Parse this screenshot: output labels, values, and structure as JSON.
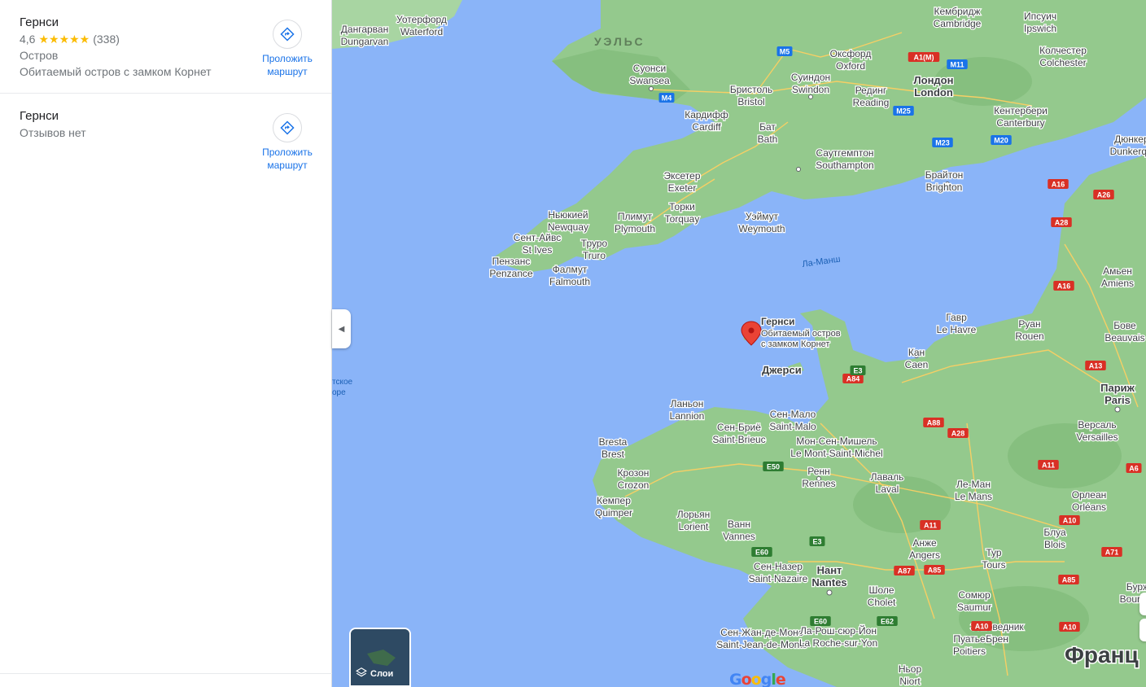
{
  "results": [
    {
      "title": "Гернси",
      "rating_value": "4,6",
      "stars": "★★★★★",
      "rating_stars": 4.6,
      "review_count": "(338)",
      "category": "Остров",
      "description": "Обитаемый остров с замком Корнет",
      "route_label_1": "Проложить",
      "route_label_2": "маршрут"
    },
    {
      "title": "Гернси",
      "reviews_text": "Отзывов нет",
      "route_label_1": "Проложить",
      "route_label_2": "маршрут"
    }
  ],
  "map": {
    "layers_label": "Слои",
    "google_logo": {
      "G": "G",
      "o1": "o",
      "o2": "o",
      "g": "g",
      "l": "l",
      "e": "e"
    },
    "pin": {
      "title": "Гернси",
      "desc_1": "Обитаемый остров",
      "desc_2": "с замком Корнет"
    },
    "region_labels": {
      "wales": "УЭЛЬС",
      "channel": "Ла-Манш",
      "sea_1": "тское",
      "sea_2": "оре",
      "france": "Франц"
    },
    "places": [
      {
        "ru": "Уотерфорд",
        "en": "Waterford"
      },
      {
        "ru": "Дангарван",
        "en": "Dungarvan"
      },
      {
        "ru": "Суонси",
        "en": "Swansea"
      },
      {
        "ru": "Бристоль",
        "en": "Bristol"
      },
      {
        "ru": "Кардифф",
        "en": "Cardiff"
      },
      {
        "ru": "Бат",
        "en": "Bath"
      },
      {
        "ru": "Оксфорд",
        "en": "Oxford"
      },
      {
        "ru": "Суиндон",
        "en": "Swindon"
      },
      {
        "ru": "Рединг",
        "en": "Reading"
      },
      {
        "ru": "Лондон",
        "en": "London"
      },
      {
        "ru": "Кембридж",
        "en": "Cambridge"
      },
      {
        "ru": "Ипсуич",
        "en": "Ipswich"
      },
      {
        "ru": "Колчестер",
        "en": "Colchester"
      },
      {
        "ru": "Кентербери",
        "en": "Canterbury"
      },
      {
        "ru": "Дюнкерк",
        "en": "Dunkerque"
      },
      {
        "ru": "Саутгемптон",
        "en": "Southampton"
      },
      {
        "ru": "Брайтон",
        "en": "Brighton"
      },
      {
        "ru": "Эксетер",
        "en": "Exeter"
      },
      {
        "ru": "Торки",
        "en": "Torquay"
      },
      {
        "ru": "Уэймут",
        "en": "Weymouth"
      },
      {
        "ru": "Плимут",
        "en": "Plymouth"
      },
      {
        "ru": "Ньюкией",
        "en": "Newquay"
      },
      {
        "ru": "Сент-Айвс",
        "en": "St Ives"
      },
      {
        "ru": "Труро",
        "en": "Truro"
      },
      {
        "ru": "Пензанс",
        "en": "Penzance"
      },
      {
        "ru": "Фалмут",
        "en": "Falmouth"
      },
      {
        "ru": "Гавр",
        "en": "Le Havre"
      },
      {
        "ru": "Руан",
        "en": "Rouen"
      },
      {
        "ru": "Бове",
        "en": "Beauvais"
      },
      {
        "ru": "Амьен",
        "en": "Amiens"
      },
      {
        "ru": "Кан",
        "en": "Caen"
      },
      {
        "ru": "Париж",
        "en": "Paris"
      },
      {
        "ru": "Версаль",
        "en": "Versailles"
      },
      {
        "ru": "Ланьон",
        "en": "Lannion"
      },
      {
        "ru": "Сен-Бриё",
        "en": "Saint-Brieuc"
      },
      {
        "ru": "Сен-Мало",
        "en": "Saint-Malo"
      },
      {
        "ru": "Мон-Сен-Мишель",
        "en": "Le Mont-Saint-Michel"
      },
      {
        "ru": "Bresta",
        "en": "Brest"
      },
      {
        "ru": "Крозон",
        "en": "Crozon"
      },
      {
        "ru": "Кемпер",
        "en": "Quimper"
      },
      {
        "ru": "Лорьян",
        "en": "Lorient"
      },
      {
        "ru": "Ванн",
        "en": "Vannes"
      },
      {
        "ru": "Ренн",
        "en": "Rennes"
      },
      {
        "ru": "Лаваль",
        "en": "Laval"
      },
      {
        "ru": "Ле-Ман",
        "en": "Le Mans"
      },
      {
        "ru": "Орлеан",
        "en": "Orléans"
      },
      {
        "ru": "Блуа",
        "en": "Blois"
      },
      {
        "ru": "Тур",
        "en": "Tours"
      },
      {
        "ru": "Анже",
        "en": "Angers"
      },
      {
        "ru": "Сомюр",
        "en": "Saumur"
      },
      {
        "ru": "Шоле",
        "en": "Cholet"
      },
      {
        "ru": "Сен-Назер",
        "en": "Saint-Nazaire"
      },
      {
        "ru": "Нант",
        "en": "Nantes"
      },
      {
        "ru": "Сен-Жан-де-Монс",
        "en": "Saint-Jean-de-Monts"
      },
      {
        "ru": "Ла-Рош-сюр-Йон",
        "en": "La Roche-sur-Yon"
      },
      {
        "ru": "Пуатье",
        "en": "Poitiers"
      },
      {
        "ru": "Ньор",
        "en": "Niort"
      },
      {
        "ru": "Бурж",
        "en": "Bourges"
      },
      {
        "ru": "Заповедник",
        "en": "Брен"
      }
    ],
    "islands": {
      "jersey": "Джерси"
    },
    "road_labels": [
      "M5",
      "A1(M)",
      "M11",
      "M4",
      "M25",
      "M23",
      "M20",
      "A16",
      "A26",
      "A28",
      "A16",
      "A13",
      "A84",
      "E3",
      "A88",
      "A28",
      "A11",
      "A6",
      "E50",
      "E60",
      "A10",
      "A11",
      "A87",
      "A85",
      "E3",
      "E60",
      "E62",
      "A10",
      "A85",
      "A71",
      "A10"
    ]
  }
}
